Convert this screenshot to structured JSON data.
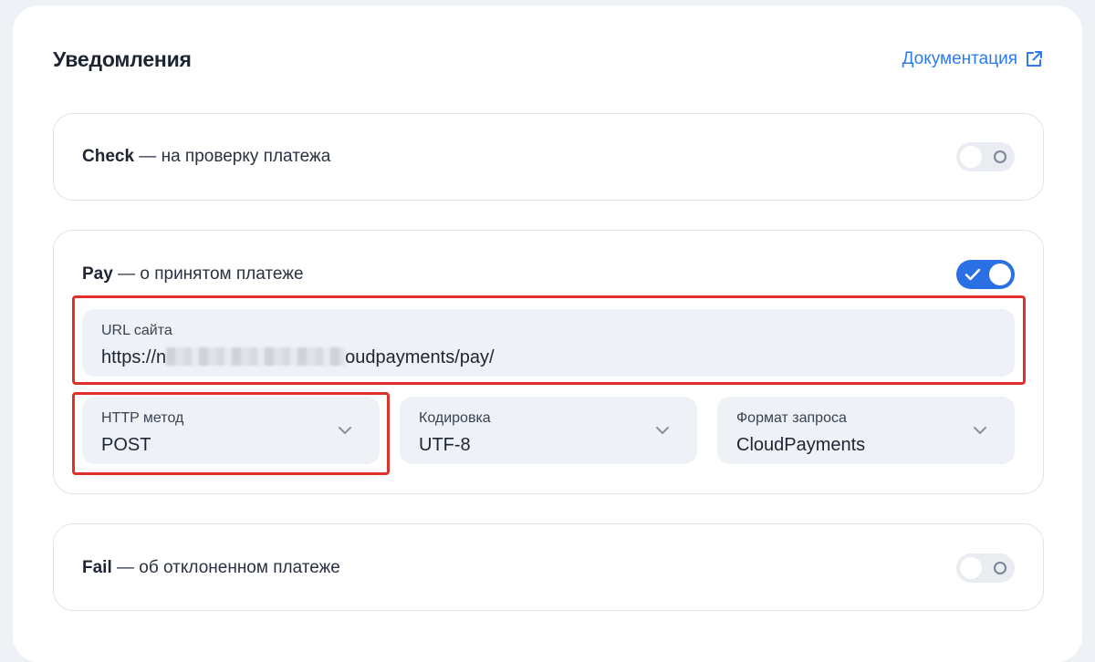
{
  "header": {
    "title": "Уведомления",
    "doc_link": "Документация"
  },
  "notifications": {
    "check": {
      "name": "Check",
      "desc": " — на проверку платежа",
      "enabled": false
    },
    "pay": {
      "name": "Pay",
      "desc": " — о принятом платеже",
      "enabled": true,
      "url": {
        "label": "URL сайта",
        "value_start": "https://n",
        "value_end": "oudpayments/pay/"
      },
      "method": {
        "label": "HTTP метод",
        "value": "POST"
      },
      "encoding": {
        "label": "Кодировка",
        "value": "UTF-8"
      },
      "format": {
        "label": "Формат запроса",
        "value": "CloudPayments"
      }
    },
    "fail": {
      "name": "Fail",
      "desc": " — об отклоненном платеже",
      "enabled": false
    }
  },
  "colors": {
    "accent": "#2a6fe3",
    "link": "#2e7bf0",
    "highlight": "#e0302b"
  },
  "icons": {
    "doc_link": "external-link-icon",
    "select": "chevron-down-icon",
    "toggle_on": "check-icon",
    "toggle_off": "circle-icon"
  }
}
